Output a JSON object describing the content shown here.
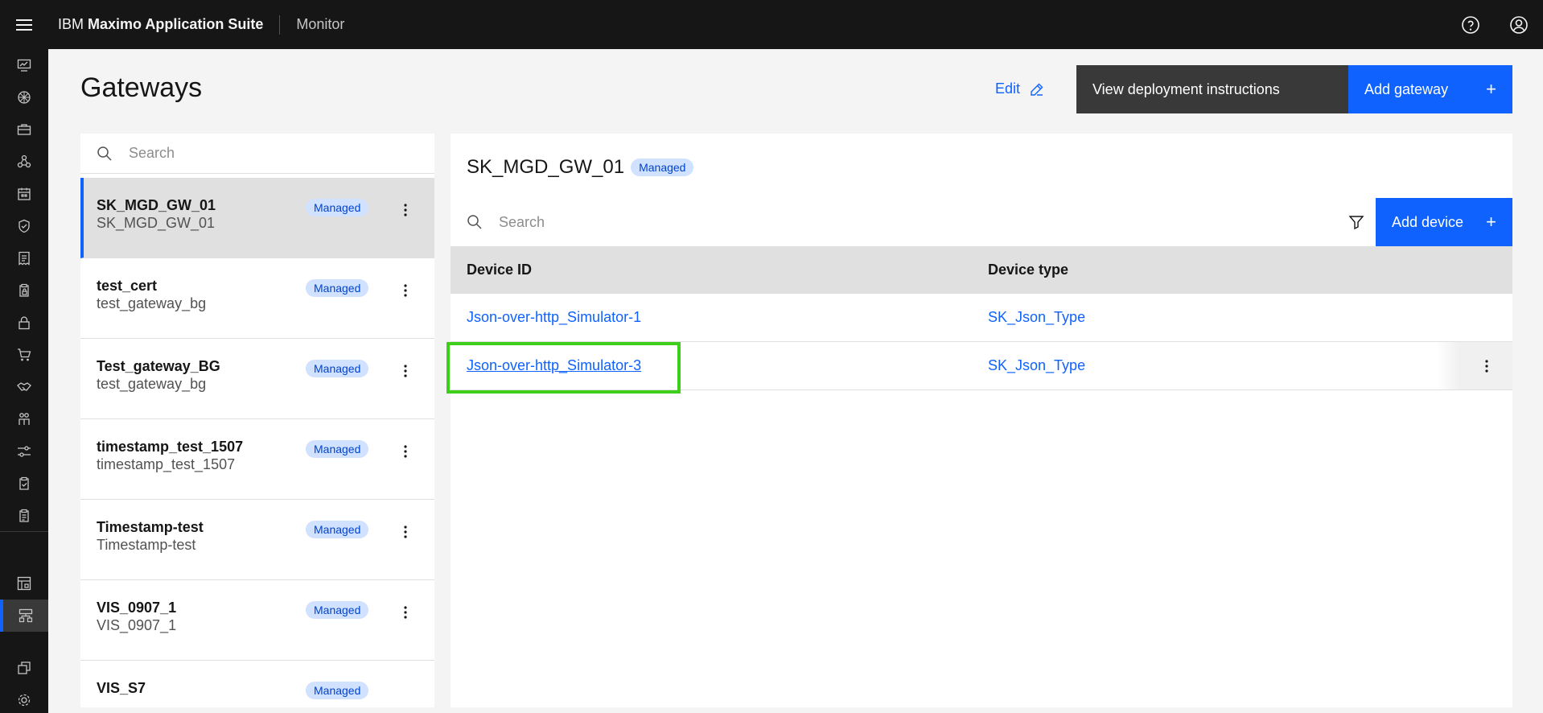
{
  "header": {
    "brand_prefix": "IBM",
    "brand_name": "Maximo Application Suite",
    "app_name": "Monitor",
    "icons": [
      "hamburger-icon",
      "help-icon",
      "user-avatar-icon"
    ]
  },
  "rail": {
    "icons": [
      "monitor-icon",
      "network-icon",
      "toolbox-icon",
      "nodes-icon",
      "calendar-icon",
      "shield-check-icon",
      "receipt-icon",
      "clipboard-lock-icon",
      "lock-icon",
      "cart-icon",
      "handshake-icon",
      "people-icon",
      "sliders-icon",
      "checklist-icon",
      "report-icon",
      "dashboard-icon",
      "gateway-icon",
      "collection-icon",
      "settings-icon"
    ],
    "active": "gateway-icon"
  },
  "page": {
    "title": "Gateways",
    "edit_label": "Edit",
    "view_deploy_label": "View deployment instructions",
    "add_gateway_label": "Add gateway",
    "plus": "+"
  },
  "gateway_list": {
    "search_placeholder": "Search",
    "items": [
      {
        "name": "SK_MGD_GW_01",
        "sub": "SK_MGD_GW_01",
        "tag": "Managed"
      },
      {
        "name": "test_cert",
        "sub": "test_gateway_bg",
        "tag": "Managed"
      },
      {
        "name": "Test_gateway_BG",
        "sub": "test_gateway_bg",
        "tag": "Managed"
      },
      {
        "name": "timestamp_test_1507",
        "sub": "timestamp_test_1507",
        "tag": "Managed"
      },
      {
        "name": "Timestamp-test",
        "sub": "Timestamp-test",
        "tag": "Managed"
      },
      {
        "name": "VIS_0907_1",
        "sub": "VIS_0907_1",
        "tag": "Managed"
      },
      {
        "name": "VIS_S7",
        "sub": "",
        "tag": "Managed"
      }
    ]
  },
  "devices": {
    "gateway_name": "SK_MGD_GW_01",
    "gateway_tag": "Managed",
    "search_placeholder": "Search",
    "add_device_label": "Add device",
    "plus": "+",
    "columns": [
      "Device ID",
      "Device type"
    ],
    "rows": [
      {
        "id": "Json-over-http_Simulator-1",
        "type": "SK_Json_Type"
      },
      {
        "id": "Json-over-http_Simulator-3",
        "type": "SK_Json_Type"
      }
    ]
  },
  "colors": {
    "primary": "#0f62fe",
    "header_bg": "#161616",
    "tag_bg": "#d0e2ff",
    "highlight": "#3ecf1a"
  }
}
